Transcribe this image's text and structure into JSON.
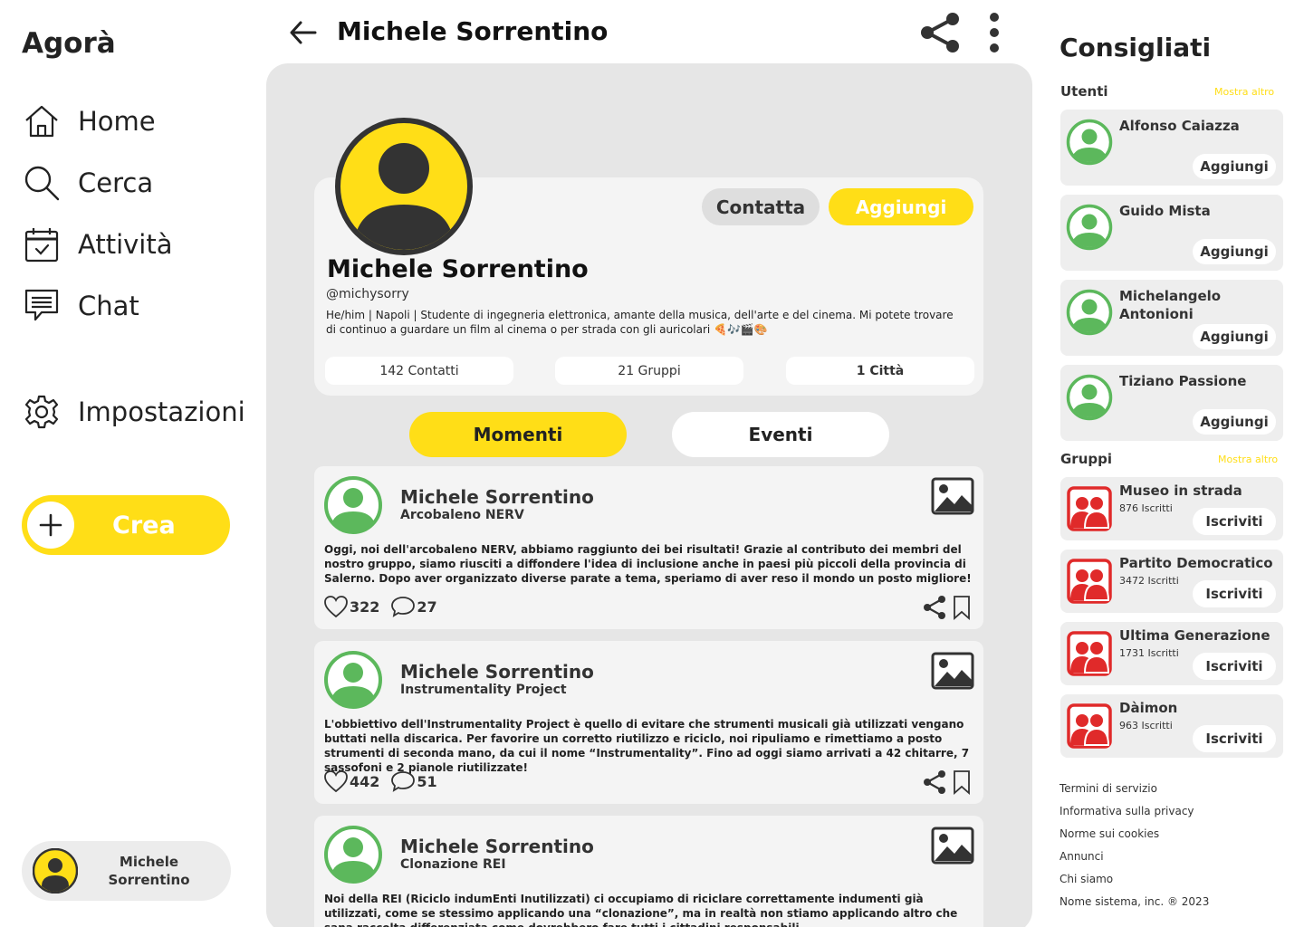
{
  "colors": {
    "accent": "#FFDE17",
    "green": "#5CB85C",
    "red": "#E02A2A",
    "dark": "#333333"
  },
  "app": {
    "name": "Agorà"
  },
  "nav": {
    "home": "Home",
    "search": "Cerca",
    "activity": "Attività",
    "chat": "Chat",
    "settings": "Impostazioni",
    "create": "Crea"
  },
  "current_user": {
    "name": "Michele Sorrentino"
  },
  "header": {
    "title": "Michele Sorrentino"
  },
  "profile": {
    "name": "Michele Sorrentino",
    "handle": "@michysorry",
    "bio": "He/him | Napoli | Studente di ingegneria elettronica, amante della musica, dell'arte e del cinema. Mi potete trovare di continuo a guardare un film al cinema o per strada con gli auricolari 🍕🎶🎬🎨",
    "contact_label": "Contatta",
    "add_label": "Aggiungi",
    "stats": {
      "contacts": "142 Contatti",
      "groups": "21 Gruppi",
      "cities": "1 Città"
    }
  },
  "tabs": {
    "moments": "Momenti",
    "events": "Eventi"
  },
  "posts": [
    {
      "author": "Michele Sorrentino",
      "group": "Arcobaleno NERV",
      "text": "Oggi, noi dell'arcobaleno NERV, abbiamo raggiunto dei bei risultati! Grazie al contributo dei membri del nostro gruppo, siamo riusciti a diffondere l'idea di inclusione anche in paesi più piccoli della provincia di Salerno. Dopo aver organizzato diverse parate a tema, speriamo di aver reso il mondo un posto migliore!",
      "likes": "322",
      "comments": "27"
    },
    {
      "author": "Michele Sorrentino",
      "group": "Instrumentality Project",
      "text": "L'obbiettivo dell'Instrumentality Project è quello di evitare che strumenti musicali già utilizzati vengano buttati nella discarica. Per favorire un corretto riutilizzo e riciclo, noi ripuliamo e rimettiamo a posto strumenti di seconda mano, da cui il nome “Instrumentality”. Fino ad oggi siamo arrivati a 42 chitarre, 7 sassofoni e 2 pianole riutilizzate!",
      "likes": "442",
      "comments": "51"
    },
    {
      "author": "Michele Sorrentino",
      "group": "Clonazione REI",
      "text": "Noi della REI (Riciclo indumEnti Inutilizzati) ci occupiamo di riciclare correttamente indumenti già utilizzati, come se stessimo applicando una “clonazione”, ma in realtà non stiamo applicando altro che sana raccolta differenziata come dovrebbero fare tutti i cittadini responsabili.",
      "likes": "",
      "comments": ""
    }
  ],
  "recommended": {
    "title": "Consigliati",
    "users_label": "Utenti",
    "groups_label": "Gruppi",
    "show_more": "Mostra altro",
    "add_label": "Aggiungi",
    "join_label": "Iscriviti",
    "users": [
      {
        "name": "Alfonso Caiazza"
      },
      {
        "name": "Guido Mista"
      },
      {
        "name": "Michelangelo Antonioni"
      },
      {
        "name": "Tiziano Passione"
      }
    ],
    "groups": [
      {
        "name": "Museo in strada",
        "members": "876 Iscritti"
      },
      {
        "name": "Partito Democratico",
        "members": "3472 Iscritti"
      },
      {
        "name": "Ultima Generazione",
        "members": "1731 Iscritti"
      },
      {
        "name": "Dàimon",
        "members": "963 Iscritti"
      }
    ]
  },
  "footer": {
    "links": [
      "Termini di servizio",
      "Informativa sulla privacy",
      "Norme sui cookies",
      "Annunci",
      "Chi siamo",
      "Nome sistema, inc. ® 2023"
    ]
  }
}
